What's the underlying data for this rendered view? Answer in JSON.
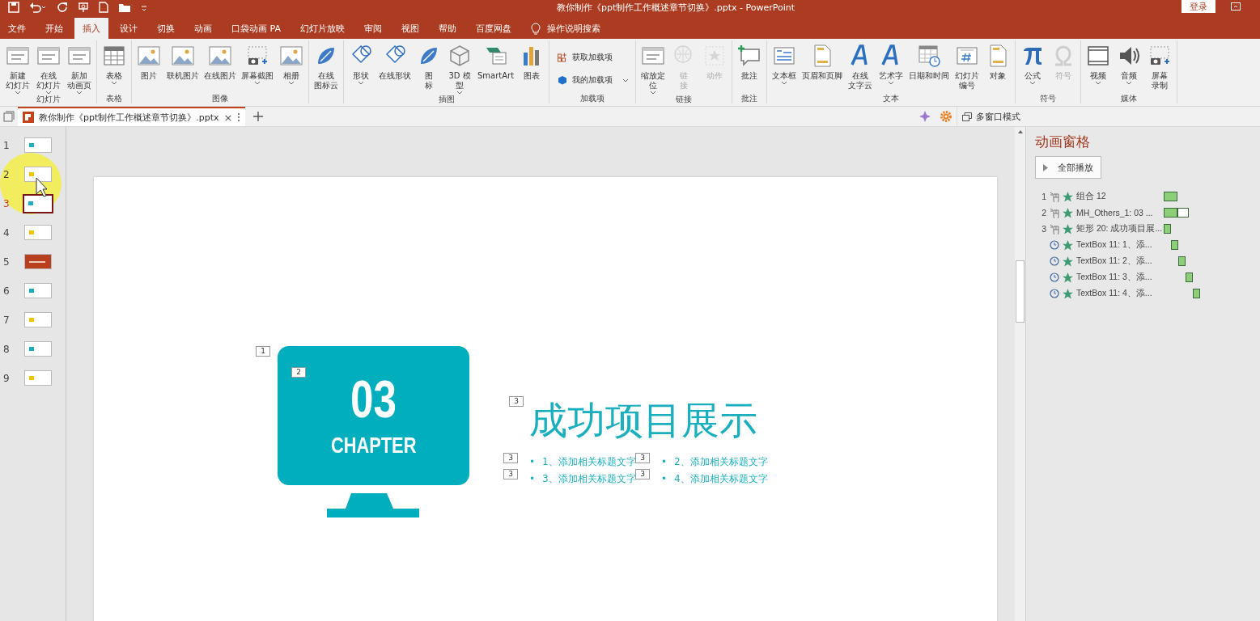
{
  "window": {
    "title": "教你制作《ppt制作工作概述章节切换》.pptx  -  PowerPoint",
    "login": "登录"
  },
  "tabs": [
    {
      "label": "文件",
      "selected": false
    },
    {
      "label": "开始",
      "selected": false
    },
    {
      "label": "插入",
      "selected": true
    },
    {
      "label": "设计",
      "selected": false
    },
    {
      "label": "切换",
      "selected": false
    },
    {
      "label": "动画",
      "selected": false
    },
    {
      "label": "口袋动画 PA",
      "selected": false
    },
    {
      "label": "幻灯片放映",
      "selected": false
    },
    {
      "label": "审阅",
      "selected": false
    },
    {
      "label": "视图",
      "selected": false
    },
    {
      "label": "帮助",
      "selected": false
    },
    {
      "label": "百度网盘",
      "selected": false
    }
  ],
  "tell_me": {
    "placeholder": "操作说明搜索"
  },
  "ribbon": [
    {
      "label": "幻灯片",
      "buttons": [
        {
          "kind": "large",
          "lines": [
            "新建",
            "幻灯片"
          ],
          "dropdown": true,
          "disabled": false
        },
        {
          "kind": "large",
          "lines": [
            "在线",
            "幻灯片"
          ],
          "dropdown": true,
          "disabled": false
        },
        {
          "kind": "large",
          "lines": [
            "新加",
            "动画页"
          ],
          "dropdown": true,
          "disabled": false
        }
      ]
    },
    {
      "label": "表格",
      "buttons": [
        {
          "kind": "large",
          "lines": [
            "表格"
          ],
          "dropdown": true,
          "disabled": false
        }
      ]
    },
    {
      "label": "图像",
      "buttons": [
        {
          "kind": "large",
          "lines": [
            "图片"
          ],
          "dropdown": false,
          "disabled": false
        },
        {
          "kind": "large",
          "lines": [
            "联机图片"
          ],
          "dropdown": false,
          "disabled": false
        },
        {
          "kind": "large",
          "lines": [
            "在线图片"
          ],
          "dropdown": false,
          "disabled": false
        },
        {
          "kind": "large",
          "lines": [
            "屏幕截图"
          ],
          "dropdown": true,
          "disabled": false
        },
        {
          "kind": "large",
          "lines": [
            "相册"
          ],
          "dropdown": true,
          "disabled": false
        }
      ]
    },
    {
      "buttons": [
        {
          "kind": "large",
          "lines": [
            "在线",
            "图标云"
          ],
          "dropdown": false,
          "disabled": false
        }
      ]
    },
    {
      "label": "插图",
      "buttons": [
        {
          "kind": "large",
          "lines": [
            "形状"
          ],
          "dropdown": true,
          "disabled": false
        },
        {
          "kind": "large",
          "lines": [
            "在线形状"
          ],
          "dropdown": false,
          "disabled": false
        },
        {
          "kind": "large",
          "lines": [
            "图",
            "标"
          ],
          "dropdown": false,
          "disabled": false
        },
        {
          "kind": "large",
          "lines": [
            "3D 模",
            "型"
          ],
          "dropdown": true,
          "disabled": false
        },
        {
          "kind": "large",
          "lines": [
            "SmartArt"
          ],
          "dropdown": false,
          "disabled": false
        },
        {
          "kind": "large",
          "lines": [
            "图表"
          ],
          "dropdown": false,
          "disabled": false
        }
      ]
    },
    {
      "label": "加载项",
      "buttons": [
        {
          "kind": "small",
          "lines": [
            "获取加载项"
          ],
          "dropdown": false,
          "disabled": false
        },
        {
          "kind": "small",
          "lines": [
            "我的加载项"
          ],
          "dropdown": true,
          "disabled": false
        }
      ]
    },
    {
      "label": "链接",
      "buttons": [
        {
          "kind": "large",
          "lines": [
            "缩放定",
            "位"
          ],
          "dropdown": true,
          "disabled": false
        },
        {
          "kind": "large",
          "lines": [
            "链",
            "接"
          ],
          "dropdown": false,
          "disabled": true
        },
        {
          "kind": "large",
          "lines": [
            "动作"
          ],
          "dropdown": false,
          "disabled": true
        }
      ]
    },
    {
      "label": "批注",
      "buttons": [
        {
          "kind": "large",
          "lines": [
            "批注"
          ],
          "dropdown": false,
          "disabled": false
        }
      ]
    },
    {
      "label": "文本",
      "buttons": [
        {
          "kind": "large",
          "lines": [
            "文本框"
          ],
          "dropdown": true,
          "disabled": false
        },
        {
          "kind": "large",
          "lines": [
            "页眉和页脚"
          ],
          "dropdown": false,
          "disabled": false
        },
        {
          "kind": "large",
          "lines": [
            "在线",
            "文字云"
          ],
          "dropdown": false,
          "disabled": false
        },
        {
          "kind": "large",
          "lines": [
            "艺术字"
          ],
          "dropdown": true,
          "disabled": false
        },
        {
          "kind": "large",
          "lines": [
            "日期和时间"
          ],
          "dropdown": false,
          "disabled": false
        },
        {
          "kind": "large",
          "lines": [
            "幻灯片",
            "编号"
          ],
          "dropdown": false,
          "disabled": false
        },
        {
          "kind": "large",
          "lines": [
            "对象"
          ],
          "dropdown": false,
          "disabled": false
        }
      ]
    },
    {
      "label": "符号",
      "buttons": [
        {
          "kind": "large",
          "lines": [
            "公式"
          ],
          "dropdown": true,
          "disabled": false
        },
        {
          "kind": "large",
          "lines": [
            "符号"
          ],
          "dropdown": false,
          "disabled": true
        }
      ]
    },
    {
      "label": "媒体",
      "buttons": [
        {
          "kind": "large",
          "lines": [
            "视频"
          ],
          "dropdown": true,
          "disabled": false
        },
        {
          "kind": "large",
          "lines": [
            "音频"
          ],
          "dropdown": true,
          "disabled": false
        },
        {
          "kind": "large",
          "lines": [
            "屏幕",
            "录制"
          ],
          "dropdown": false,
          "disabled": false
        }
      ]
    }
  ],
  "document_tab": {
    "title": "教你制作《ppt制作工作概述章节切换》.pptx",
    "close": "×"
  },
  "multi_window": "多窗口模式",
  "thumbnails": [
    {
      "number": "1",
      "selected": false,
      "kind": "light",
      "color": "#1aaebf"
    },
    {
      "number": "2",
      "selected": false,
      "kind": "light",
      "color": "#f2c500"
    },
    {
      "number": "3",
      "selected": true,
      "kind": "light",
      "color": "#1aaebf"
    },
    {
      "number": "4",
      "selected": false,
      "kind": "light",
      "color": "#f2c500"
    },
    {
      "number": "5",
      "selected": false,
      "kind": "dark",
      "color": "#b8401f"
    },
    {
      "number": "6",
      "selected": false,
      "kind": "light",
      "color": "#1aaebf"
    },
    {
      "number": "7",
      "selected": false,
      "kind": "light",
      "color": "#f2c500"
    },
    {
      "number": "8",
      "selected": false,
      "kind": "light",
      "color": "#1aaebf"
    },
    {
      "number": "9",
      "selected": false,
      "kind": "light",
      "color": "#f2c500"
    }
  ],
  "slide": {
    "number": "03",
    "chapter": "CHAPTER",
    "title": "成功项目展示",
    "bullets": [
      {
        "marker": "•",
        "text": "1、添加相关标题文字"
      },
      {
        "marker": "•",
        "text": "2、添加相关标题文字"
      },
      {
        "marker": "•",
        "text": "3、添加相关标题文字"
      },
      {
        "marker": "•",
        "text": "4、添加相关标题文字"
      }
    ],
    "tags": [
      {
        "kind": "monitor",
        "label": "1"
      },
      {
        "kind": "number",
        "label": "2"
      },
      {
        "kind": "title",
        "label": "3"
      },
      {
        "kind": "bullet",
        "label": "3"
      },
      {
        "kind": "bullet",
        "label": "3"
      },
      {
        "kind": "bullet",
        "label": "3"
      },
      {
        "kind": "bullet",
        "label": "3"
      }
    ]
  },
  "animation_pane": {
    "title": "动画窗格",
    "play_all": "全部播放",
    "items": [
      {
        "number": "1",
        "kind": "click",
        "label": "组合 12",
        "bars": [
          {
            "filled": true
          }
        ]
      },
      {
        "number": "2",
        "kind": "click",
        "label": "MH_Others_1: 03 ...",
        "bars": [
          {
            "filled": true
          },
          {
            "filled": false
          }
        ]
      },
      {
        "number": "3",
        "kind": "click",
        "label": "矩形 20: 成功项目展...",
        "bars": [
          {
            "filled": true
          }
        ]
      },
      {
        "kind": "after",
        "label": "TextBox 11: 1、添...",
        "bars": [
          {
            "filled": true
          }
        ]
      },
      {
        "kind": "after",
        "label": "TextBox 11: 2、添...",
        "bars": [
          {
            "filled": true
          }
        ]
      },
      {
        "kind": "after",
        "label": "TextBox 11: 3、添...",
        "bars": [
          {
            "filled": true
          }
        ]
      },
      {
        "kind": "after",
        "label": "TextBox 11: 4、添...",
        "bars": [
          {
            "filled": true
          }
        ]
      }
    ]
  }
}
